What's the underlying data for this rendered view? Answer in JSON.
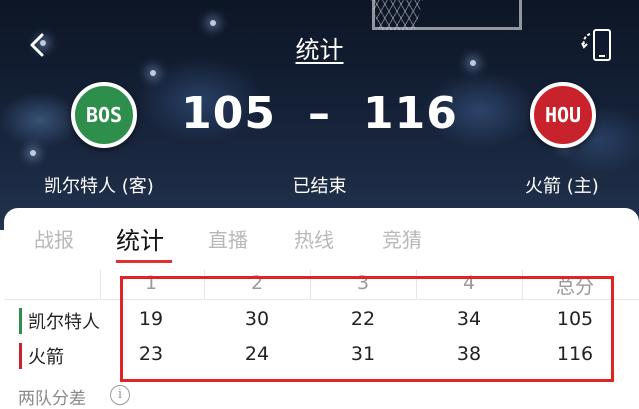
{
  "header": {
    "title": "统计",
    "status": "已结束"
  },
  "teams": {
    "away": {
      "logo_text": "BOS",
      "name": "凯尔特人 (客)",
      "score": "105",
      "color": "#2e8f4c"
    },
    "home": {
      "logo_text": "HOU",
      "name": "火箭 (主)",
      "score": "116",
      "color": "#c8222c"
    }
  },
  "score_separator": "–",
  "tabs": [
    {
      "label": "战报",
      "active": false
    },
    {
      "label": "统计",
      "active": true
    },
    {
      "label": "直播",
      "active": false
    },
    {
      "label": "热线",
      "active": false
    },
    {
      "label": "竞猜",
      "active": false
    }
  ],
  "quarter_table": {
    "headers": [
      "1",
      "2",
      "3",
      "4",
      "总分"
    ],
    "rows": [
      {
        "team": "凯尔特人",
        "color": "#2e8f4c",
        "values": [
          "19",
          "30",
          "22",
          "34",
          "105"
        ]
      },
      {
        "team": "火箭",
        "color": "#c8222c",
        "values": [
          "23",
          "24",
          "31",
          "38",
          "116"
        ]
      }
    ]
  },
  "diff_section": {
    "label": "两队分差",
    "info_symbol": "i"
  },
  "colors": {
    "accent": "#e0332e",
    "highlight_box": "#e02424"
  },
  "icons": {
    "back": "chevron-left-icon",
    "rotate": "rotate-screen-icon",
    "info": "info-icon"
  }
}
